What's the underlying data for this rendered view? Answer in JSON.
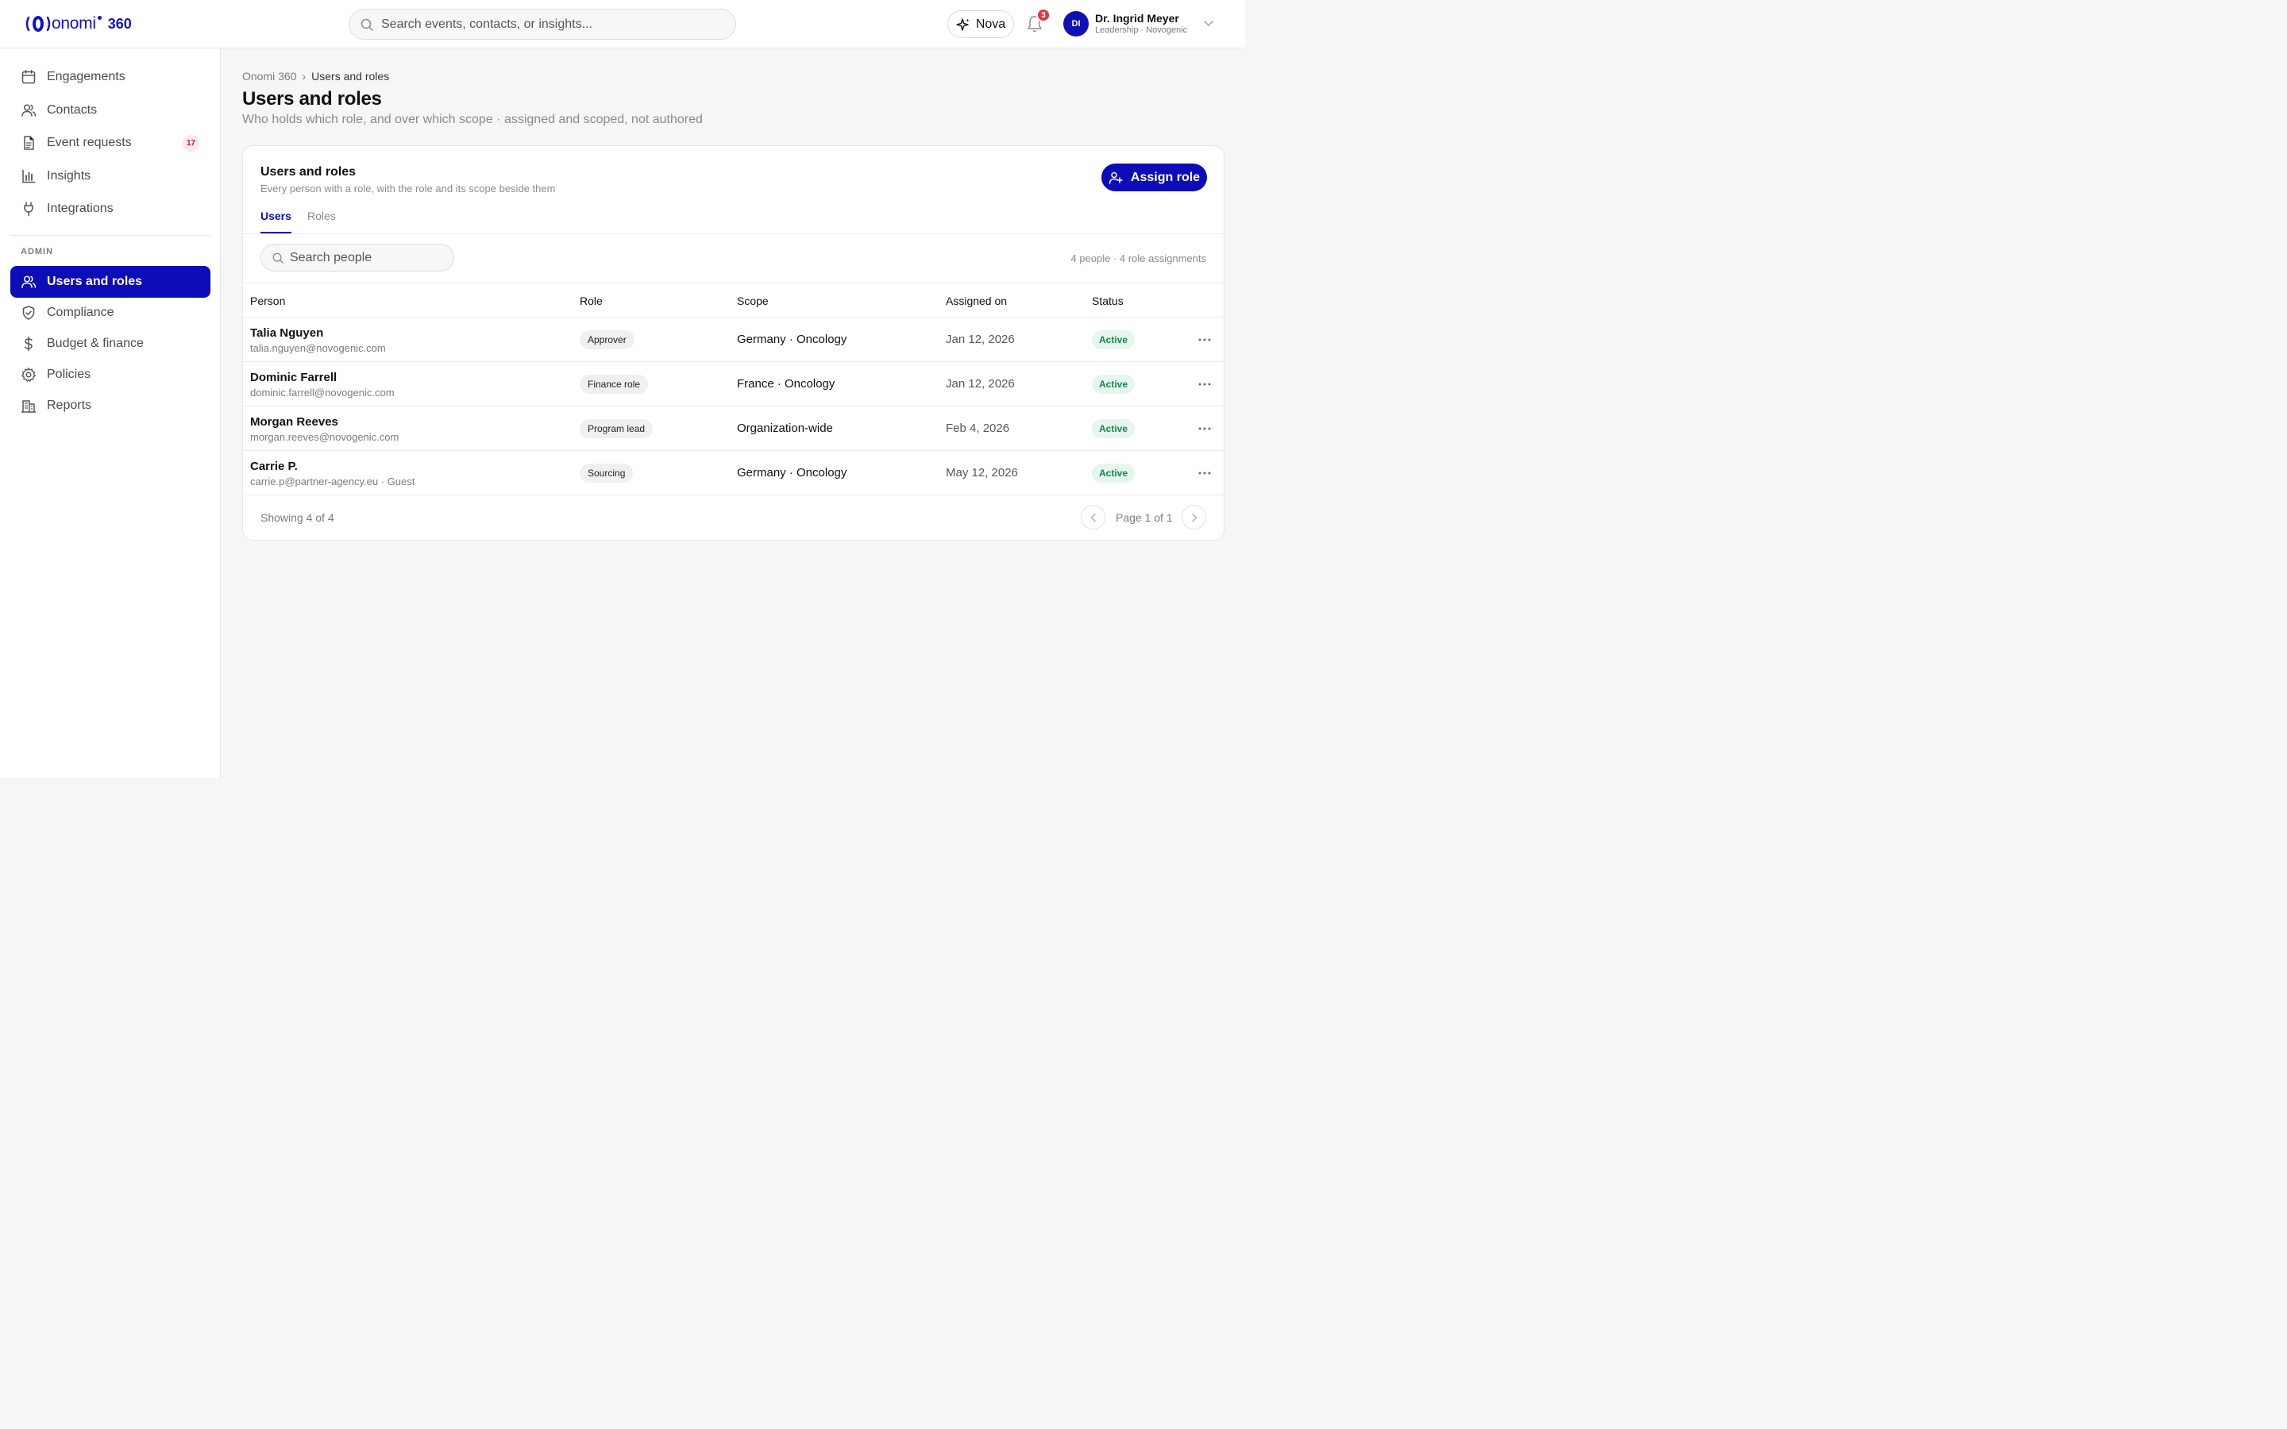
{
  "app": {
    "logo_text": "onomi",
    "logo_suffix": "360",
    "brand_color": "#0c0cb8"
  },
  "header": {
    "search_placeholder": "Search events, contacts, or insights...",
    "nova_label": "Nova",
    "notifications_count": "3",
    "user": {
      "initials": "DI",
      "name": "Dr. Ingrid Meyer",
      "role": "Leadership · Novogenic"
    }
  },
  "sidebar": {
    "items": [
      {
        "label": "Engagements",
        "icon": "calendar-icon"
      },
      {
        "label": "Contacts",
        "icon": "users-icon"
      },
      {
        "label": "Event requests",
        "icon": "document-icon",
        "badge": "17"
      },
      {
        "label": "Insights",
        "icon": "bar-chart-icon"
      },
      {
        "label": "Integrations",
        "icon": "plug-icon"
      }
    ],
    "admin_label": "ADMIN",
    "admin_items": [
      {
        "label": "Users and roles",
        "icon": "users-icon",
        "active": true
      },
      {
        "label": "Compliance",
        "icon": "shield-check-icon"
      },
      {
        "label": "Budget & finance",
        "icon": "dollar-icon"
      },
      {
        "label": "Policies",
        "icon": "gear-icon"
      },
      {
        "label": "Reports",
        "icon": "building-icon"
      }
    ]
  },
  "page": {
    "breadcrumb_root": "Onomi 360",
    "breadcrumb_sep": "›",
    "breadcrumb_current": "Users and roles",
    "title": "Users and roles",
    "subtitle": "Who holds which role, and over which scope · assigned and scoped, not authored"
  },
  "card": {
    "title": "Users and roles",
    "subtitle": "Every person with a role, with the role and its scope beside them",
    "assign_label": "Assign role",
    "tabs": [
      {
        "label": "Users",
        "active": true
      },
      {
        "label": "Roles",
        "active": false
      }
    ],
    "search_placeholder": "Search people",
    "counts": "4 people · 4 role assignments",
    "columns": [
      "Person",
      "Role",
      "Scope",
      "Assigned on",
      "Status"
    ],
    "rows": [
      {
        "name": "Talia Nguyen",
        "email": "talia.nguyen@novogenic.com",
        "role": "Approver",
        "scope": "Germany · Oncology",
        "assigned": "Jan 12, 2026",
        "status": "Active"
      },
      {
        "name": "Dominic Farrell",
        "email": "dominic.farrell@novogenic.com",
        "role": "Finance role",
        "scope": "France · Oncology",
        "assigned": "Jan 12, 2026",
        "status": "Active"
      },
      {
        "name": "Morgan Reeves",
        "email": "morgan.reeves@novogenic.com",
        "role": "Program lead",
        "scope": "Organization-wide",
        "assigned": "Feb 4, 2026",
        "status": "Active"
      },
      {
        "name": "Carrie P.",
        "email": "carrie.p@partner-agency.eu · Guest",
        "role": "Sourcing",
        "scope": "Germany · Oncology",
        "assigned": "May 12, 2026",
        "status": "Active"
      }
    ],
    "showing": "Showing 4 of 4",
    "page_label": "Page 1 of 1"
  }
}
